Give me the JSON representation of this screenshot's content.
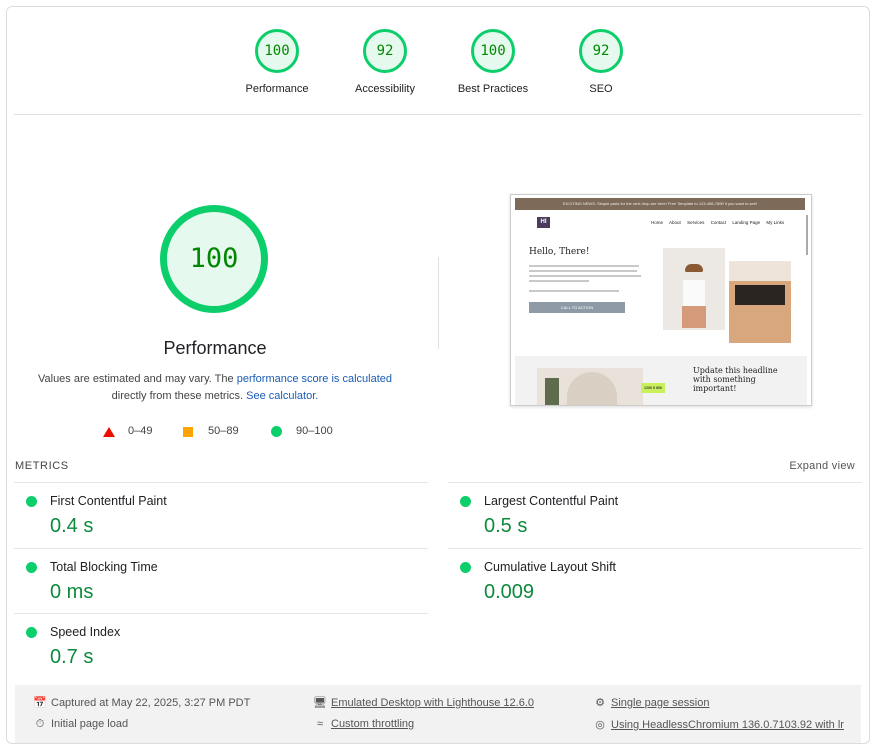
{
  "categories": [
    {
      "label": "Performance",
      "score": "100"
    },
    {
      "label": "Accessibility",
      "score": "92"
    },
    {
      "label": "Best Practices",
      "score": "100"
    },
    {
      "label": "SEO",
      "score": "92"
    }
  ],
  "main": {
    "score": "100",
    "title": "Performance",
    "disclaimer_pre": "Values are estimated and may vary. The ",
    "disclaimer_link1": "performance score is calculated",
    "disclaimer_mid": " directly from these metrics. ",
    "disclaimer_link2": "See calculator.",
    "legend": [
      {
        "range": "0–49",
        "color": "#eb0f00"
      },
      {
        "range": "50–89",
        "color": "#ffa400"
      },
      {
        "range": "90–100",
        "color": "#0cce6b"
      }
    ]
  },
  "thumbnail": {
    "banner": "EXCITING NEWS: Simple parts for the next drop are here! Free Template to 123-456-7890 if you want to see!",
    "logo": "HI",
    "nav": [
      "Home",
      "About",
      "Services",
      "Contact",
      "Landing Page",
      "My Links"
    ],
    "hello": "Hello, There!",
    "cta": "CALL TO ACTION",
    "badge": "1200 X 600",
    "headline": "Update this headline with something important!"
  },
  "metrics": {
    "title": "METRICS",
    "expand_label": "Expand view",
    "items": [
      {
        "name": "First Contentful Paint",
        "value": "0.4 s"
      },
      {
        "name": "Largest Contentful Paint",
        "value": "0.5 s"
      },
      {
        "name": "Total Blocking Time",
        "value": "0 ms"
      },
      {
        "name": "Cumulative Layout Shift",
        "value": "0.009"
      },
      {
        "name": "Speed Index",
        "value": "0.7 s"
      }
    ],
    "color_good": "#0cce6b"
  },
  "footer": {
    "captured": "Captured at May 22, 2025, 3:27 PM PDT",
    "initial": "Initial page load",
    "emulated": "Emulated Desktop with Lighthouse 12.6.0",
    "throttling": "Custom throttling",
    "session": "Single page session",
    "browser": "Using HeadlessChromium 136.0.7103.92 with lr"
  }
}
